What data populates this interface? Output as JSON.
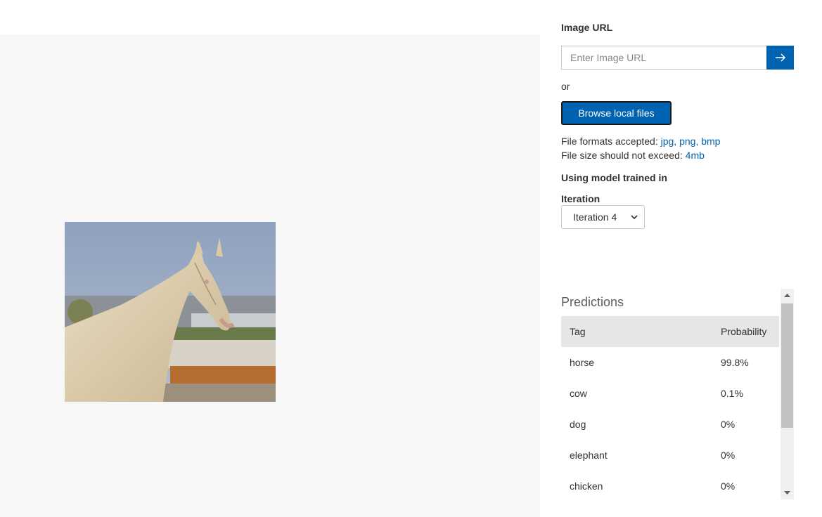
{
  "image_url": {
    "label": "Image URL",
    "placeholder": "Enter Image URL",
    "submit_icon": "arrow-right-icon"
  },
  "or_text": "or",
  "browse_label": "Browse local files",
  "formats": {
    "prefix": "File formats accepted: ",
    "value": "jpg, png, bmp"
  },
  "size_limit": {
    "prefix": "File size should not exceed: ",
    "value": "4mb"
  },
  "model_heading": "Using model trained in",
  "iteration": {
    "label": "Iteration",
    "selected": "Iteration 4"
  },
  "predictions": {
    "title": "Predictions",
    "columns": {
      "tag": "Tag",
      "probability": "Probability"
    },
    "rows": [
      {
        "tag": "horse",
        "probability": "99.8%"
      },
      {
        "tag": "cow",
        "probability": "0.1%"
      },
      {
        "tag": "dog",
        "probability": "0%"
      },
      {
        "tag": "elephant",
        "probability": "0%"
      },
      {
        "tag": "chicken",
        "probability": "0%"
      }
    ]
  },
  "colors": {
    "accent": "#0063b1",
    "pane_background": "#f7f7f7",
    "header_row": "#e6e6e6"
  }
}
